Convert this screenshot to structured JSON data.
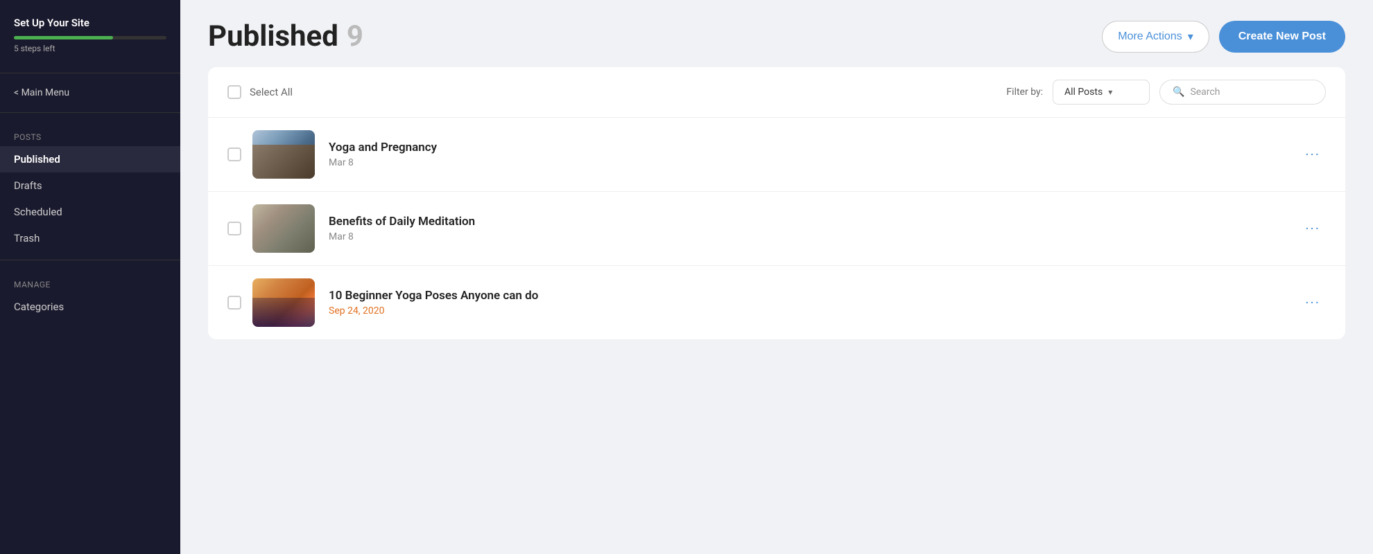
{
  "sidebar": {
    "site_setup": {
      "title": "Set Up Your Site",
      "steps_left": "5 steps left",
      "progress_percent": 65
    },
    "main_menu_label": "< Main Menu",
    "sections": [
      {
        "label": "Posts",
        "items": [
          {
            "id": "published",
            "label": "Published",
            "active": true
          },
          {
            "id": "drafts",
            "label": "Drafts",
            "active": false
          },
          {
            "id": "scheduled",
            "label": "Scheduled",
            "active": false
          },
          {
            "id": "trash",
            "label": "Trash",
            "active": false
          }
        ]
      },
      {
        "label": "Manage",
        "items": [
          {
            "id": "categories",
            "label": "Categories",
            "active": false
          }
        ]
      }
    ]
  },
  "header": {
    "page_title": "Published",
    "post_count": "9",
    "more_actions_label": "More Actions",
    "more_actions_chevron": "▾",
    "create_post_label": "Create New Post"
  },
  "toolbar": {
    "select_all_label": "Select All",
    "filter_by_label": "Filter by:",
    "filter_option": "All Posts",
    "filter_chevron": "▾",
    "search_placeholder": "Search",
    "search_icon": "🔍"
  },
  "posts": [
    {
      "id": "post-1",
      "title": "Yoga and Pregnancy",
      "date": "Mar 8",
      "date_highlight": false,
      "thumb_class": "thumb-yoga-pregnancy"
    },
    {
      "id": "post-2",
      "title": "Benefits of Daily Meditation",
      "date": "Mar 8",
      "date_highlight": false,
      "thumb_class": "thumb-meditation"
    },
    {
      "id": "post-3",
      "title": "10 Beginner Yoga Poses Anyone can do",
      "date": "Sep 24, 2020",
      "date_highlight": true,
      "thumb_class": "thumb-poses"
    }
  ]
}
